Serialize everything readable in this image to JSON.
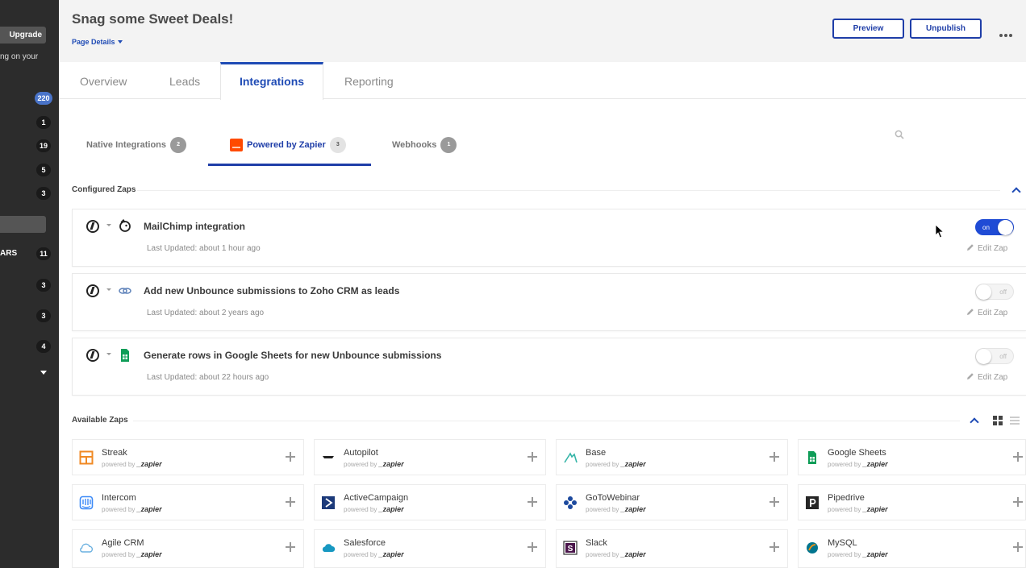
{
  "sidebar": {
    "upgrade_label": "Upgrade",
    "text_snippet": "ng on your",
    "counts": [
      "220",
      "1",
      "19",
      "5",
      "3",
      "11",
      "3",
      "3",
      "4"
    ],
    "section_label": "ARS"
  },
  "header": {
    "title": "Snag some Sweet Deals!",
    "page_details": "Page Details",
    "preview_label": "Preview",
    "unpublish_label": "Unpublish"
  },
  "tabs": {
    "overview": "Overview",
    "leads": "Leads",
    "integrations": "Integrations",
    "reporting": "Reporting"
  },
  "subtabs": {
    "native": {
      "label": "Native Integrations",
      "count": "2"
    },
    "zapier": {
      "label": "Powered by Zapier",
      "count": "3"
    },
    "webhooks": {
      "label": "Webhooks",
      "count": "1"
    }
  },
  "configured": {
    "title": "Configured Zaps",
    "edit_label": "Edit Zap",
    "zaps": [
      {
        "name": "MailChimp integration",
        "updated": "Last Updated:  about 1 hour ago",
        "toggle": "on",
        "icon": "mailchimp-icon"
      },
      {
        "name": "Add new Unbounce submissions to Zoho CRM as leads",
        "updated": "Last Updated:  about 2 years ago",
        "toggle": "off",
        "icon": "zoho-icon"
      },
      {
        "name": "Generate rows in Google Sheets for new Unbounce submissions",
        "updated": "Last Updated:  about 22 hours ago",
        "toggle": "off",
        "icon": "google-sheets-icon"
      }
    ]
  },
  "available": {
    "title": "Available Zaps",
    "powered_by": "powered by",
    "zapier_word": "_zapier",
    "apps": [
      {
        "name": "Streak",
        "icon": "streak-icon",
        "color": "#f08a24"
      },
      {
        "name": "Autopilot",
        "icon": "autopilot-icon",
        "color": "#222222"
      },
      {
        "name": "Base",
        "icon": "base-icon",
        "color": "#36b5a8"
      },
      {
        "name": "Google Sheets",
        "icon": "google-sheets-icon",
        "color": "#0f9d58"
      },
      {
        "name": "Intercom",
        "icon": "intercom-icon",
        "color": "#3d8af7"
      },
      {
        "name": "ActiveCampaign",
        "icon": "activecampaign-icon",
        "color": "#1c3a7a"
      },
      {
        "name": "GoToWebinar",
        "icon": "gotowebinar-icon",
        "color": "#1d4a9e"
      },
      {
        "name": "Pipedrive",
        "icon": "pipedrive-icon",
        "color": "#262626"
      },
      {
        "name": "Agile CRM",
        "icon": "agile-crm-icon",
        "color": "#6ab0e0"
      },
      {
        "name": "Salesforce",
        "icon": "salesforce-icon",
        "color": "#1798c1"
      },
      {
        "name": "Slack",
        "icon": "slack-icon",
        "color": "#4a154b"
      },
      {
        "name": "MySQL",
        "icon": "mysql-icon",
        "color": "#00758f"
      }
    ]
  },
  "colors": {
    "accent": "#1f4bb5",
    "toggle_on": "#1f4bd5",
    "sidebar_bg": "#2c2c2c"
  }
}
